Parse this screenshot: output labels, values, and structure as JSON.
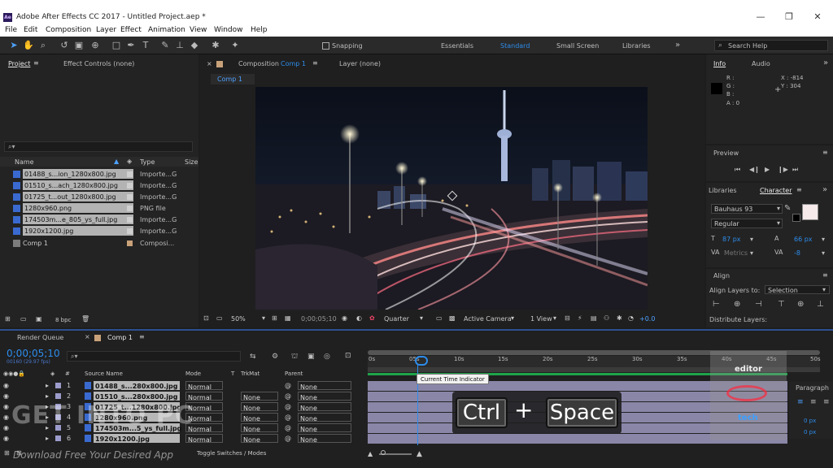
{
  "window": {
    "title": "Adobe After Effects CC 2017 - Untitled Project.aep *",
    "app_icon": "Ae",
    "minimize": "—",
    "maximize": "❐",
    "close": "✕"
  },
  "menu": [
    "File",
    "Edit",
    "Composition",
    "Layer",
    "Effect",
    "Animation",
    "View",
    "Window",
    "Help"
  ],
  "toolbar": {
    "snapping_label": "Snapping",
    "workspaces": [
      "Essentials",
      "Standard",
      "Small Screen",
      "Libraries"
    ],
    "active_workspace": "Standard",
    "search_placeholder": "Search Help"
  },
  "project_panel": {
    "tab_project": "Project",
    "tab_effect_controls": "Effect Controls (none)",
    "search_icon": "⌕▾",
    "col_name": "Name",
    "col_type": "Type",
    "col_size": "Size",
    "items": [
      {
        "name": "01488_s...ion_1280x800.jpg",
        "type": "Importe...G"
      },
      {
        "name": "01510_s...ach_1280x800.jpg",
        "type": "Importe...G"
      },
      {
        "name": "01725_t...out_1280x800.jpg",
        "type": "Importe...G"
      },
      {
        "name": "1280x960.png",
        "type": "PNG file"
      },
      {
        "name": "174503m...e_805_ys_full.jpg",
        "type": "Importe...G"
      },
      {
        "name": "1920x1200.jpg",
        "type": "Importe...G"
      },
      {
        "name": "Comp 1",
        "type": "Composi..."
      }
    ],
    "bpc": "8 bpc"
  },
  "composition_panel": {
    "tab_comp_prefix": "Composition",
    "tab_comp_name": "Comp 1",
    "tab_layer": "Layer (none)",
    "breadcrumb": "Comp 1",
    "zoom": "50%",
    "timecode": "0;00;05;10",
    "resolution": "Quarter",
    "camera": "Active Camera",
    "views": "1 View",
    "exposure": "+0.0"
  },
  "info_panel": {
    "tab_info": "Info",
    "tab_audio": "Audio",
    "r": "R :",
    "g": "G :",
    "b": "B :",
    "a": "A :  0",
    "x": "X : -814",
    "y": "Y : 304"
  },
  "preview_panel": {
    "title": "Preview"
  },
  "character_panel": {
    "tab_libraries": "Libraries",
    "tab_character": "Character",
    "font": "Bauhaus 93",
    "style": "Regular",
    "size": "87 px",
    "leading": "66 px",
    "kerning": "Metrics",
    "tracking": "-8"
  },
  "align_panel": {
    "title": "Align",
    "align_to_label": "Align Layers to:",
    "align_to_value": "Selection",
    "distribute": "Distribute Layers:"
  },
  "timeline": {
    "tab_render": "Render Queue",
    "tab_comp": "Comp 1",
    "timecode": "0;00;05;10",
    "fps": "00160 (29.97 fps)",
    "col_num": "#",
    "col_source": "Source Name",
    "col_mode": "Mode",
    "col_t": "T",
    "col_trkmat": "TrkMat",
    "col_parent": "Parent",
    "ruler": [
      "0s",
      "05s",
      "10s",
      "15s",
      "20s",
      "25s",
      "30s",
      "35s",
      "40s",
      "45s",
      "50s"
    ],
    "tooltip": "Current Time Indicator",
    "layers": [
      {
        "num": "1",
        "name": "01488_s...280x800.jpg",
        "mode": "Normal",
        "trkmat": "",
        "parent": "None"
      },
      {
        "num": "2",
        "name": "01510_s...280x800.jpg",
        "mode": "Normal",
        "trkmat": "None",
        "parent": "None"
      },
      {
        "num": "3",
        "name": "01725_t...1280x800.jpg",
        "mode": "Normal",
        "trkmat": "None",
        "parent": "None"
      },
      {
        "num": "4",
        "name": "1280x960.png",
        "mode": "Normal",
        "trkmat": "None",
        "parent": "None"
      },
      {
        "num": "5",
        "name": "174503m...5_ys_full.jpg",
        "mode": "Normal",
        "trkmat": "None",
        "parent": "None"
      },
      {
        "num": "6",
        "name": "1920x1200.jpg",
        "mode": "Normal",
        "trkmat": "None",
        "parent": "None"
      }
    ],
    "toggle_label": "Toggle Switches / Modes"
  },
  "paragraph_panel": {
    "title": "Paragraph",
    "indent1": "0 px",
    "indent2": "0 px"
  },
  "overlay": {
    "key1": "Ctrl",
    "plus": "+",
    "key2": "Space",
    "watermark_main": "GET INTO PC",
    "watermark_sub": "Download Free Your Desired App",
    "logo_top": "editor",
    "logo_bottom": "tech"
  },
  "colors": {
    "accent_blue": "#2d8ceb",
    "layer_bar": "#8a86a8",
    "panel_bg": "#232323"
  }
}
